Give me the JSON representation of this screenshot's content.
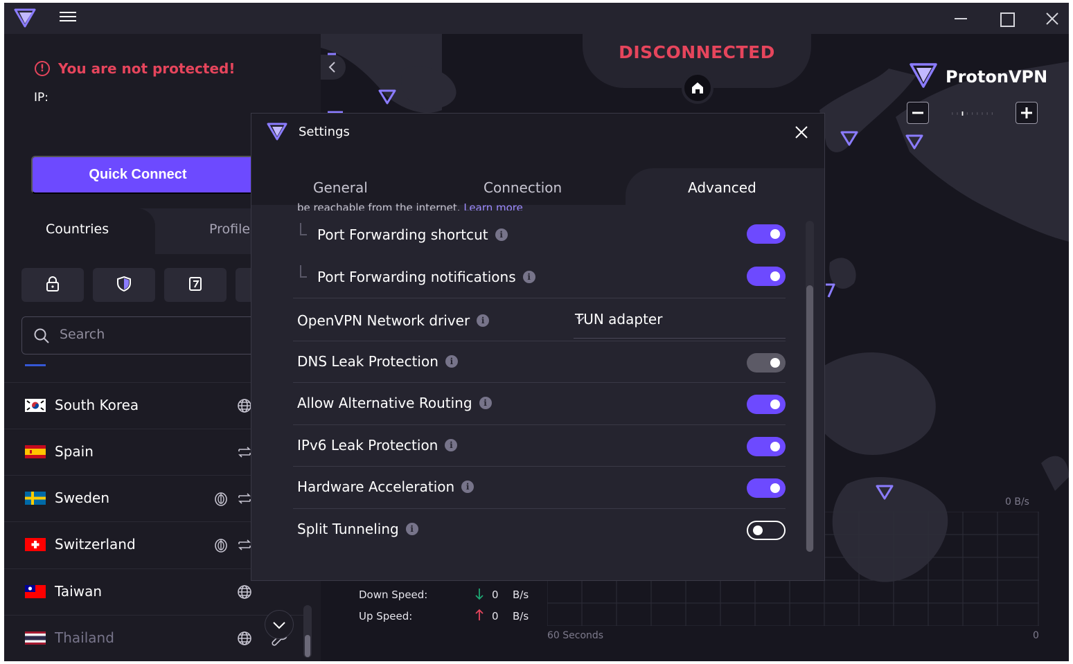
{
  "left": {
    "warning": "You are not protected!",
    "ip_label": "IP:",
    "quick_connect": "Quick Connect",
    "tabs": {
      "countries": "Countries",
      "profiles": "Profile"
    },
    "search_placeholder": "Search",
    "countries": [
      {
        "name": "South Korea",
        "icons": [
          "globe-icon"
        ]
      },
      {
        "name": "Spain",
        "icons": [
          "p2p-arrows-icon"
        ]
      },
      {
        "name": "Sweden",
        "icons": [
          "tor-icon",
          "p2p-arrows-icon"
        ]
      },
      {
        "name": "Switzerland",
        "icons": [
          "tor-icon",
          "p2p-arrows-icon"
        ]
      },
      {
        "name": "Taiwan",
        "icons": [
          "globe-icon"
        ]
      },
      {
        "name": "Thailand",
        "icons": [
          "globe-icon",
          "wrench-icon"
        ]
      }
    ]
  },
  "map": {
    "status": "DISCONNECTED",
    "brand": "ProtonVPN",
    "down_speed_label": "Down Speed:",
    "up_speed_label": "Up Speed:",
    "down_value": "0",
    "up_value": "0",
    "unit": "B/s",
    "chart_max": "0 B/s",
    "chart_seconds": "60 Seconds",
    "chart_zero": "0"
  },
  "settings": {
    "title": "Settings",
    "tabs": [
      "General",
      "Connection",
      "Advanced"
    ],
    "active_tab": "Advanced",
    "cut_text": "be reachable from the internet.",
    "learn_more": "Learn more",
    "rows": [
      {
        "label": "Port Forwarding shortcut",
        "state": "on"
      },
      {
        "label": "Port Forwarding notifications",
        "state": "on"
      },
      {
        "label": "OpenVPN Network driver",
        "value": "TUN adapter"
      },
      {
        "label": "DNS Leak Protection",
        "state": "on-disabled"
      },
      {
        "label": "Allow Alternative Routing",
        "state": "on"
      },
      {
        "label": "IPv6 Leak Protection",
        "state": "on"
      },
      {
        "label": "Hardware Acceleration",
        "state": "on"
      },
      {
        "label": "Split Tunneling",
        "state": "off"
      }
    ]
  },
  "colors": {
    "accent": "#6d4aff",
    "danger": "#e6455c",
    "background": "#17161f",
    "panel": "#25242f"
  }
}
